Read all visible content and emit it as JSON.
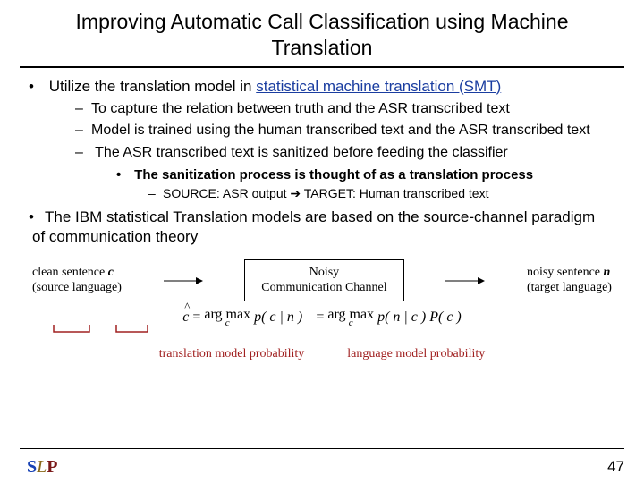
{
  "title": "Improving Automatic Call Classification using Machine Translation",
  "bullets": {
    "b1_pre": "Utilize the translation model in ",
    "b1_link": "statistical machine translation (SMT)",
    "d1": "To capture the relation between truth and the ASR transcribed text",
    "d2": "Model is trained using the human transcribed text and the ASR transcribed text",
    "d3": "The ASR transcribed text is sanitized before feeding the classifier",
    "sb1": "The sanitization process is thought of as a translation process",
    "sd1": "SOURCE: ASR output ➔ TARGET: Human transcribed text",
    "b2": "The IBM statistical Translation models are based on the source-channel paradigm of communication theory"
  },
  "diagram": {
    "left1": "clean sentence ",
    "left_var": "c",
    "left2": "(source language)",
    "box1": "Noisy",
    "box2": "Communication Channel",
    "right1": "noisy sentence ",
    "right_var": "n",
    "right2": "(target language)"
  },
  "eq": {
    "argmax": "arg max",
    "c": "c",
    "line1_rhs": "p( c | n )",
    "line2_rhs": "p( n | c ) P( c )"
  },
  "labels": {
    "tm": "translation model probability",
    "lm": "language model probability"
  },
  "page": "47"
}
